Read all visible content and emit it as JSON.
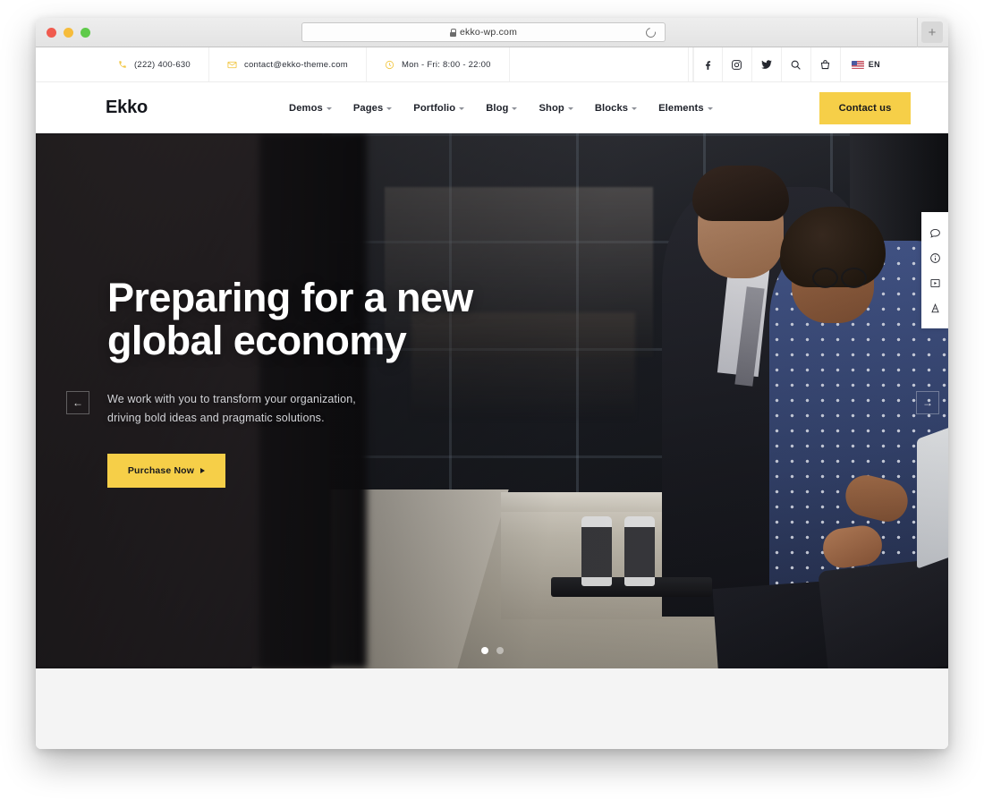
{
  "browser": {
    "url": "ekko-wp.com",
    "lock_icon": "lock-icon",
    "reload_icon": "reload-icon",
    "new_tab_label": "+"
  },
  "topbar": {
    "phone": {
      "icon": "phone-icon",
      "text": "(222) 400-630"
    },
    "email": {
      "icon": "envelope-icon",
      "text": "contact@ekko-theme.com"
    },
    "hours": {
      "icon": "clock-icon",
      "text": "Mon - Fri: 8:00 - 22:00"
    },
    "social": [
      {
        "name": "facebook-icon",
        "glyph": "f"
      },
      {
        "name": "instagram-icon",
        "glyph": ""
      },
      {
        "name": "twitter-icon",
        "glyph": ""
      }
    ],
    "actions": [
      {
        "name": "search-icon"
      },
      {
        "name": "cart-icon"
      }
    ],
    "language": {
      "flag": "us-flag-icon",
      "label": "EN"
    }
  },
  "header": {
    "logo": "Ekko",
    "menu": [
      {
        "label": "Demos",
        "has_dropdown": true
      },
      {
        "label": "Pages",
        "has_dropdown": true
      },
      {
        "label": "Portfolio",
        "has_dropdown": true
      },
      {
        "label": "Blog",
        "has_dropdown": true
      },
      {
        "label": "Shop",
        "has_dropdown": true
      },
      {
        "label": "Blocks",
        "has_dropdown": true
      },
      {
        "label": "Elements",
        "has_dropdown": true
      }
    ],
    "cta": "Contact us"
  },
  "hero": {
    "title_line1": "Preparing for a new",
    "title_line2": "global economy",
    "subtitle_line1": "We work with you to transform your organization,",
    "subtitle_line2": "driving bold ideas and pragmatic solutions.",
    "button": "Purchase Now",
    "prev_arrow": "←",
    "next_arrow": "→",
    "slides": [
      {
        "index": 1,
        "active": true
      },
      {
        "index": 2,
        "active": false
      }
    ]
  },
  "side_panel": [
    {
      "name": "chat-bubble-icon"
    },
    {
      "name": "info-circle-icon"
    },
    {
      "name": "video-play-icon"
    },
    {
      "name": "bag-icon"
    }
  ],
  "colors": {
    "accent_yellow": "#f6cf48",
    "text_dark": "#18191d",
    "page_bg": "#f4f4f4"
  }
}
